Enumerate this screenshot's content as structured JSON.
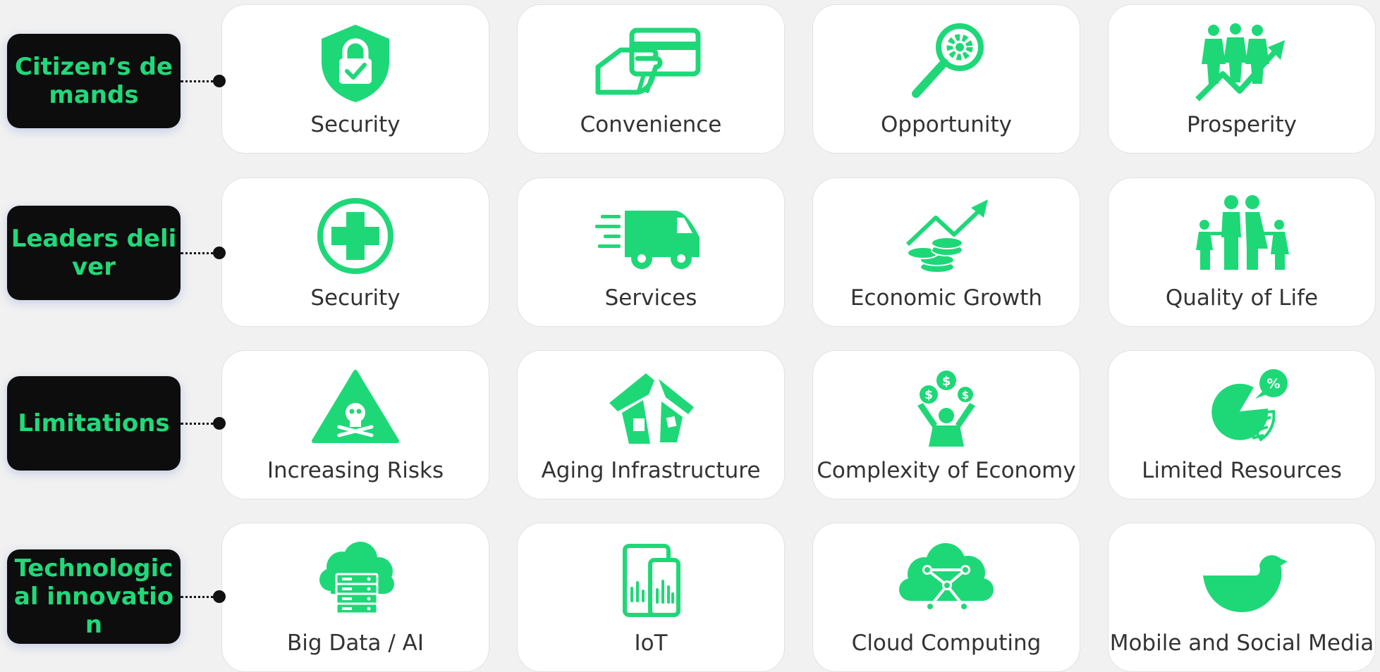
{
  "theme": {
    "accent": "#1ed877",
    "label_bg": "#0d0d0d",
    "card_bg": "#ffffff",
    "page_bg": "#f1f1f1"
  },
  "rows": [
    {
      "label": "Citizen’s demands",
      "items": [
        {
          "text": "Security",
          "icon": "shield-lock-icon"
        },
        {
          "text": "Convenience",
          "icon": "card-in-hand-icon"
        },
        {
          "text": "Opportunity",
          "icon": "magnifier-gear-icon"
        },
        {
          "text": "Prosperity",
          "icon": "people-rising-arrow-icon"
        }
      ]
    },
    {
      "label": "Leaders deliver",
      "items": [
        {
          "text": "Security",
          "icon": "medical-cross-icon"
        },
        {
          "text": "Services",
          "icon": "delivery-van-icon"
        },
        {
          "text": "Economic Growth",
          "icon": "coins-growth-icon"
        },
        {
          "text": "Quality of Life",
          "icon": "family-icon"
        }
      ]
    },
    {
      "label": "Limitations",
      "items": [
        {
          "text": "Increasing Risks",
          "icon": "hazard-skull-icon"
        },
        {
          "text": "Aging Infrastructure",
          "icon": "broken-house-icon"
        },
        {
          "text": "Complexity of Economy",
          "icon": "person-money-icon"
        },
        {
          "text": "Limited Resources",
          "icon": "pie-percent-icon"
        }
      ]
    },
    {
      "label": "Technological innovation",
      "items": [
        {
          "text": "Big Data / AI",
          "icon": "cloud-server-icon"
        },
        {
          "text": "IoT",
          "icon": "devices-icon"
        },
        {
          "text": "Cloud Computing",
          "icon": "cloud-network-icon"
        },
        {
          "text": "Mobile and Social Media",
          "icon": "bird-icon"
        }
      ]
    }
  ]
}
